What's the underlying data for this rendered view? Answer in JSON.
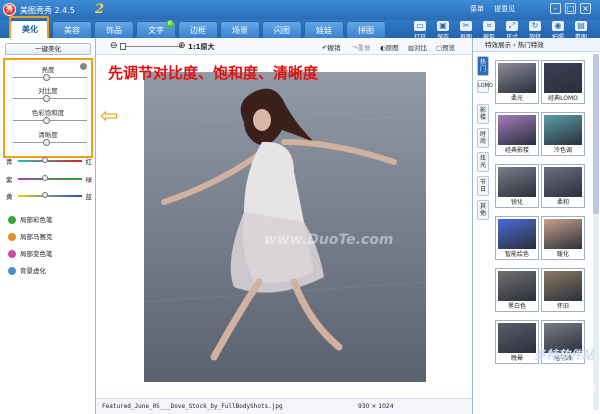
{
  "titlebar": {
    "app_title": "美图秀秀 2.4.5",
    "logo_text": "2",
    "links": [
      "菜单",
      "提意见"
    ],
    "window_buttons": [
      "-",
      "□",
      "×"
    ]
  },
  "tabs": [
    {
      "label": "美化",
      "active": true
    },
    {
      "label": "美容"
    },
    {
      "label": "饰品"
    },
    {
      "label": "文字",
      "badge": "新"
    },
    {
      "label": "边框"
    },
    {
      "label": "场景"
    },
    {
      "label": "闪图"
    },
    {
      "label": "娃娃"
    },
    {
      "label": "拼图"
    }
  ],
  "toolbar_tools": [
    {
      "label": "打开",
      "icon": "open-icon"
    },
    {
      "label": "保存",
      "icon": "save-icon"
    },
    {
      "label": "抠图",
      "icon": "cutout-icon"
    },
    {
      "label": "裁剪",
      "icon": "crop-icon"
    },
    {
      "label": "尺寸",
      "icon": "resize-icon"
    },
    {
      "label": "旋转",
      "icon": "rotate-icon"
    },
    {
      "label": "拍照",
      "icon": "camera-icon"
    },
    {
      "label": "看图",
      "icon": "view-icon"
    }
  ],
  "left_panel": {
    "one_key": "一键美化",
    "adjustments": [
      {
        "label": "亮度",
        "value": 0.5
      },
      {
        "label": "对比度",
        "value": 0.5
      },
      {
        "label": "色彩饱和度",
        "value": 0.5
      },
      {
        "label": "清晰度",
        "value": 0.5
      }
    ],
    "color_balance": [
      {
        "left": "青",
        "right": "红",
        "value": 0.5,
        "color": "#e02020"
      },
      {
        "left": "紫",
        "right": "绿",
        "value": 0.5,
        "color": "#20b020"
      },
      {
        "left": "黄",
        "right": "蓝",
        "value": 0.5,
        "color": "#2050e0"
      }
    ],
    "tools": [
      {
        "label": "局部彩色笔",
        "color": "#3aa53a"
      },
      {
        "label": "局部马赛克",
        "color": "#e0902a"
      },
      {
        "label": "局部变色笔",
        "color": "#d04aa0"
      },
      {
        "label": "背景虚化",
        "color": "#4a90d0"
      }
    ]
  },
  "annotation": "先调节对比度、饱和度、清晰度",
  "canvas": {
    "zoom_label": "1:1原大",
    "actions": [
      "撤销",
      "重做",
      "原图",
      "对比",
      "预览"
    ],
    "watermark": "www.DuoTe.com",
    "file_name": "Featured_June_05___Dove_Stock_by_FullBodyShots.jpg",
    "image_size": "930 × 1024"
  },
  "right_panel": {
    "header": "特效展示 › 热门特效",
    "vtabs": [
      "热门",
      "LOMO",
      "影楼",
      "时尚",
      "炫光",
      "节日",
      "其他"
    ],
    "effects": [
      {
        "label": "柔光",
        "color": "#8c8a9a"
      },
      {
        "label": "经典LOMO",
        "color": "#3a3f55"
      },
      {
        "label": "经典影楼",
        "color": "#a57bc0"
      },
      {
        "label": "冷色调",
        "color": "#5a9fa8"
      },
      {
        "label": "锐化",
        "color": "#7a7e8a"
      },
      {
        "label": "柔和",
        "color": "#6c7080"
      },
      {
        "label": "智能绘色",
        "color": "#4b6ad8"
      },
      {
        "label": "暖化",
        "color": "#c7a18a"
      },
      {
        "label": "黑白色",
        "color": "#707070"
      },
      {
        "label": "怀旧",
        "color": "#8a7a62"
      },
      {
        "label": "晚晕",
        "color": "#585e6c"
      },
      {
        "label": "电视线",
        "color": "#777c86"
      }
    ]
  },
  "footer": {
    "logo": "多特软件站",
    "tagline": "国内最安全的软件站"
  }
}
